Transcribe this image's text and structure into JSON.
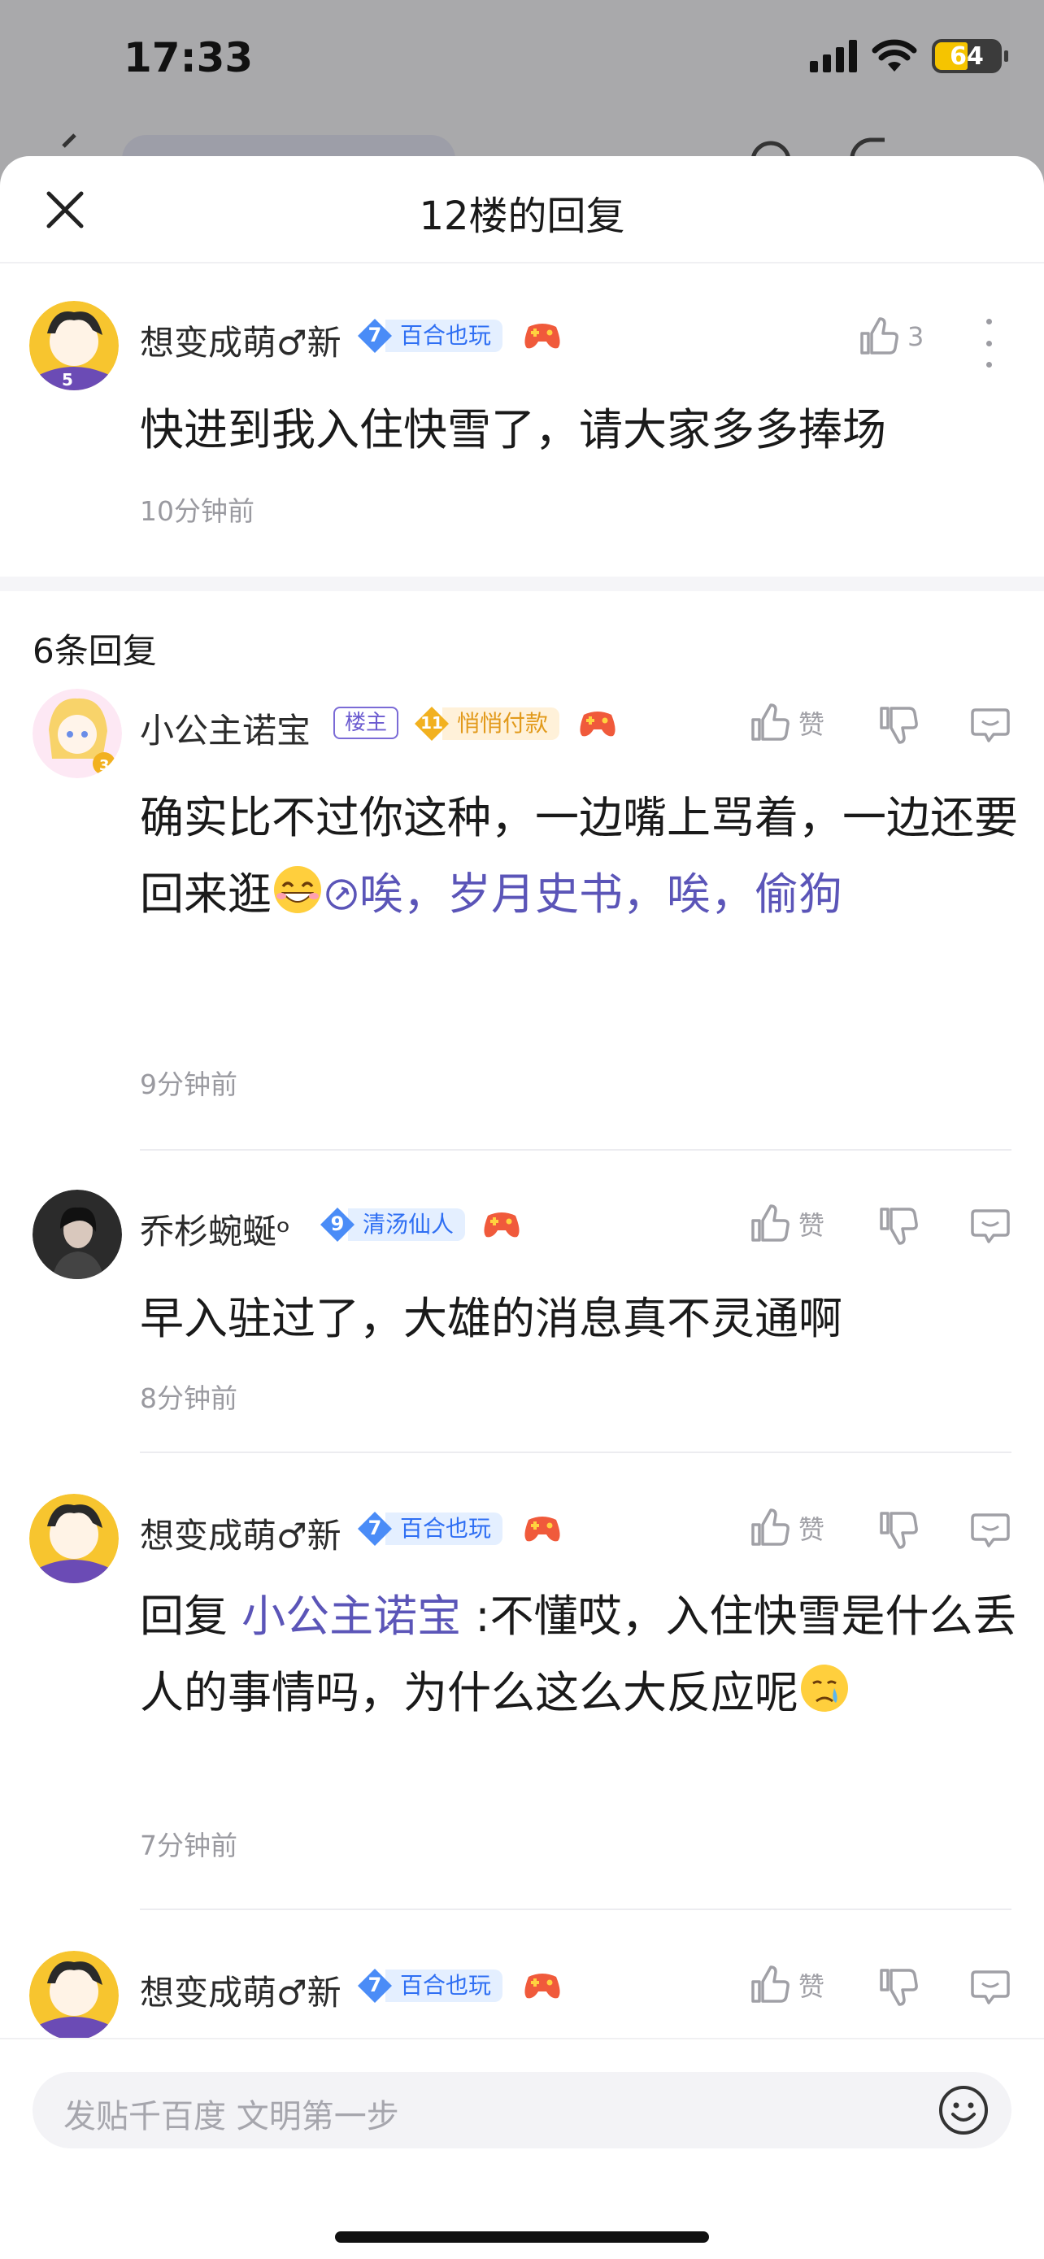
{
  "status_bar": {
    "time": "17:33",
    "battery": "64"
  },
  "sheet": {
    "title": "12楼的回复"
  },
  "original_post": {
    "username": "想变成萌♂新",
    "level": "7",
    "level_title": "百合也玩",
    "likes": "3",
    "content": "快进到我入住快雪了，请大家多多捧场",
    "time": "10分钟前"
  },
  "reply_count_label": "6条回复",
  "replies": [
    {
      "username": "小公主诺宝",
      "owner_tag": "楼主",
      "level": "11",
      "level_title": "悄悄付款",
      "content_a": "确实比不过你这种，一边嘴上骂着，一边还要回来逛",
      "mention": "唉，岁月史书，唉，偷狗",
      "time": "9分钟前",
      "like_label": "赞"
    },
    {
      "username": "乔杉蜿蜒ᵒ",
      "level": "9",
      "level_title": "清汤仙人",
      "content": "早入驻过了，大雄的消息真不灵通啊",
      "time": "8分钟前",
      "like_label": "赞"
    },
    {
      "username": "想变成萌♂新",
      "level": "7",
      "level_title": "百合也玩",
      "reply_prefix": "回复 ",
      "reply_to": "小公主诺宝",
      "content": " :不懂哎，入住快雪是什么丢人的事情吗，为什么这么大反应呢",
      "time": "7分钟前",
      "like_label": "赞"
    },
    {
      "username": "想变成萌♂新",
      "level": "7",
      "level_title": "百合也玩",
      "like_label": "赞"
    }
  ],
  "input": {
    "placeholder": "发贴千百度 文明第一步"
  },
  "colors": {
    "link": "#5b55b8",
    "level_blue": "#2f6ff3",
    "level_gold": "#e29a1b"
  }
}
